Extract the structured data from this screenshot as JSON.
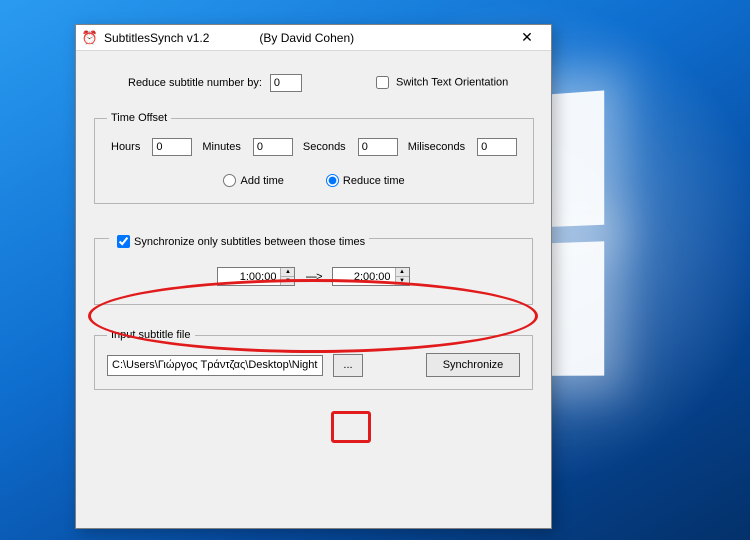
{
  "window": {
    "title": "SubtitlesSynch v1.2",
    "author": "(By David Cohen)"
  },
  "reduce": {
    "label": "Reduce subtitle number by:",
    "value": "0"
  },
  "switch_orientation": {
    "label": "Switch Text Orientation",
    "checked": false
  },
  "time_offset": {
    "legend": "Time Offset",
    "hours_label": "Hours",
    "hours_value": "0",
    "minutes_label": "Minutes",
    "minutes_value": "0",
    "seconds_label": "Seconds",
    "seconds_value": "0",
    "ms_label": "Miliseconds",
    "ms_value": "0",
    "add_label": "Add time",
    "reduce_label": "Reduce time",
    "selected": "reduce"
  },
  "sync_range": {
    "checkbox_label": "Synchronize only subtitles between those times",
    "checked": true,
    "from": "1:00:00",
    "to": "2:00:00",
    "separator": "---->"
  },
  "input_file": {
    "legend": "Input subtitle file",
    "path": "C:\\Users\\Γιώργος Τράντζας\\Desktop\\Night Of",
    "browse_label": "...",
    "sync_label": "Synchronize"
  }
}
